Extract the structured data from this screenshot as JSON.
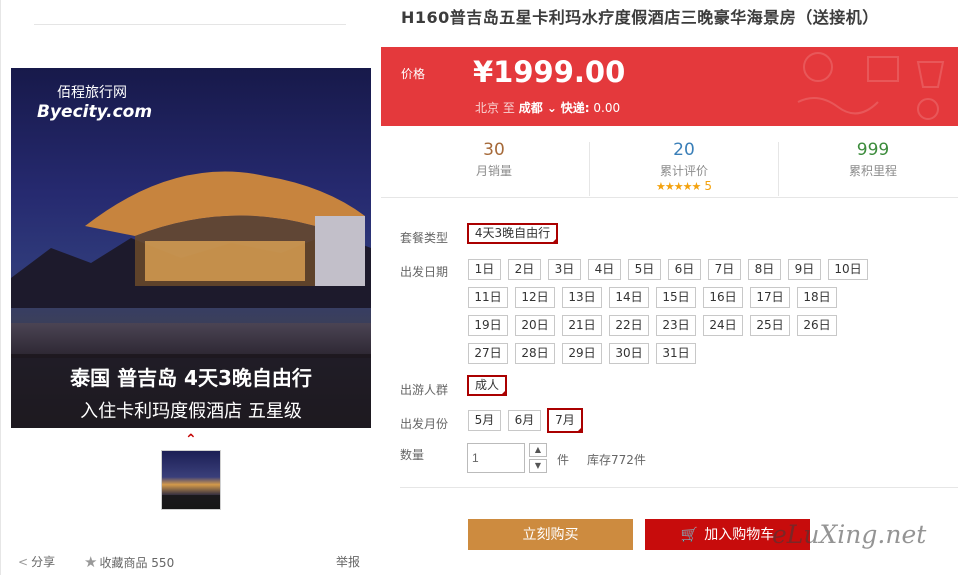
{
  "title": "H160普吉岛五星卡利玛水疗度假酒店三晚豪华海景房（送接机）",
  "image": {
    "logo_cn": "佰程旅行网",
    "logo_en": "Byecity.com",
    "caption_line1": "泰国 普吉岛 4天3晚自由行",
    "caption_line2": "入住卡利玛度假酒店 五星级"
  },
  "left_actions": {
    "share": "分享",
    "favorite": "收藏商品",
    "favorite_count": "550",
    "report": "举报"
  },
  "price": {
    "label": "价格",
    "value": "¥1999.00",
    "route_from": "北京",
    "route_to_word": "至",
    "route_city": "成都",
    "express_label": "快递:",
    "express_value": "0.00"
  },
  "stats": [
    {
      "num": "30",
      "label": "月销量"
    },
    {
      "num": "20",
      "label": "累计评价",
      "rating": "5"
    },
    {
      "num": "999",
      "label": "累积里程"
    }
  ],
  "options": {
    "package_label": "套餐类型",
    "package_value": "4天3晚自由行",
    "date_label": "出发日期",
    "dates": [
      "1日",
      "2日",
      "3日",
      "4日",
      "5日",
      "6日",
      "7日",
      "8日",
      "9日",
      "10日",
      "11日",
      "12日",
      "13日",
      "14日",
      "15日",
      "16日",
      "17日",
      "18日",
      "19日",
      "20日",
      "21日",
      "22日",
      "23日",
      "24日",
      "25日",
      "26日",
      "27日",
      "28日",
      "29日",
      "30日",
      "31日"
    ],
    "people_label": "出游人群",
    "people_value": "成人",
    "month_label": "出发月份",
    "months": [
      "5月",
      "6月",
      "7月"
    ],
    "selected_month": "7月",
    "qty_label": "数量",
    "qty_value": "1",
    "qty_unit": "件",
    "stock": "库存772件"
  },
  "buttons": {
    "buy": "立刻购买",
    "cart": "加入购物车"
  },
  "watermark": "eLuXing.net",
  "colors": {
    "price_bg": "#e4393c",
    "buy_btn": "#cd8b3f",
    "cart_btn": "#c70c0c",
    "selected_border": "#aa0000"
  }
}
